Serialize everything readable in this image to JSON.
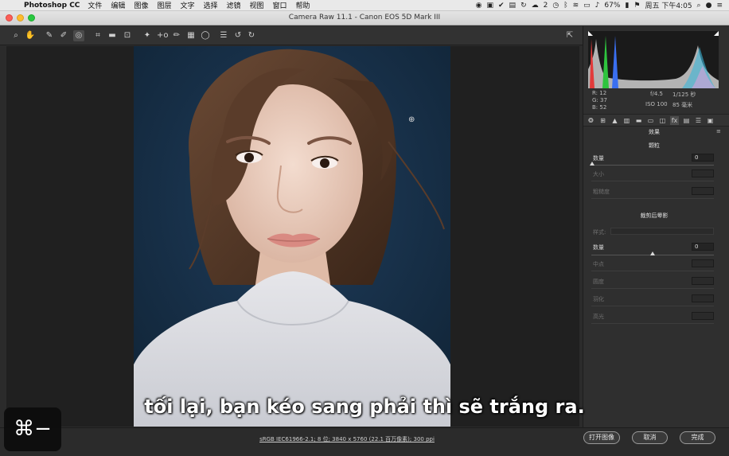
{
  "menubar": {
    "app_name": "Photoshop CC",
    "items": [
      "文件",
      "编辑",
      "图像",
      "图层",
      "文字",
      "选择",
      "滤镜",
      "视图",
      "窗口",
      "帮助"
    ],
    "wechat_count": "2",
    "battery": "67%",
    "clock": "周五 下午4:05"
  },
  "window": {
    "title": "Camera Raw 11.1 -  Canon EOS 5D Mark III"
  },
  "readout": {
    "r_label": "R:",
    "r_value": "12",
    "g_label": "G:",
    "g_value": "37",
    "b_label": "B:",
    "b_value": "52",
    "aperture": "f/4.5",
    "shutter": "1/125 秒",
    "iso": "ISO 100",
    "focal": "85 毫米"
  },
  "effects_panel": {
    "title": "效果",
    "grain": {
      "title": "颗粒",
      "amount_label": "数量",
      "amount_value": "0",
      "size_label": "大小",
      "roughness_label": "粗糙度"
    },
    "vignette": {
      "title": "裁剪后晕影",
      "style_label": "样式:",
      "amount_label": "数量",
      "amount_value": "0",
      "midpoint_label": "中点",
      "roundness_label": "圆度",
      "feather_label": "羽化",
      "highlights_label": "高光"
    }
  },
  "bottom": {
    "workflow_info": "sRGB IEC61966-2.1; 8 位; 3840 x 5760 (22.1 百万像素); 300 ppi",
    "open_button": "打开图像",
    "cancel_button": "取消",
    "done_button": "完成"
  },
  "overlay": {
    "subtitle": "tối lại, bạn kéo sang phải thì sẽ trắng ra.",
    "keystroke": "⌘−"
  },
  "colors": {
    "photo_background": "#163049",
    "panel_background": "#2f2f2f",
    "canvas_background": "#202020"
  }
}
